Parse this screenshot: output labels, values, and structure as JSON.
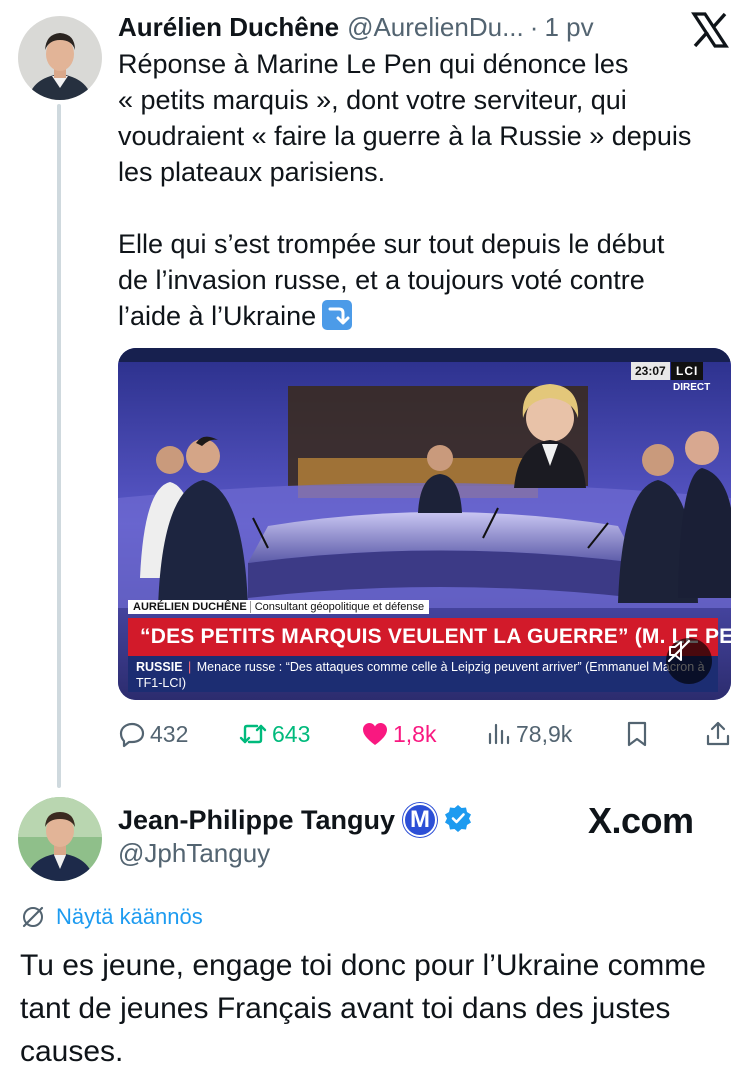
{
  "tweet1": {
    "author_name": "Aurélien Duchêne",
    "handle": "@AurelienDu...",
    "separator": "·",
    "time": "1 pv",
    "body": "Réponse à Marine Le Pen qui dénonce les\n« petits marquis », dont votre serviteur, qui\nvoudraient « faire la guerre à la Russie » depuis\nles plateaux parisiens.\n\nElle qui s’est trompée sur tout depuis le début\nde l’invasion russe, et a toujours voté contre\nl’aide à l’Ukraine",
    "emoji": "right-arrow-curving-down-emoji",
    "media": {
      "clock": "23:07",
      "channel": "LCI",
      "live_label": "DIRECT",
      "lower_third_name": "AURÉLIEN DUCHÊNE",
      "lower_third_role": "Consultant géopolitique et défense",
      "headline": "“DES PETITS MARQUIS VEULENT LA GUERRE” (M. LE PEN)",
      "ticker_label": "RUSSIE",
      "ticker_sep": "|",
      "ticker_text": "Menace russe : “Des attaques comme celle à Leipzig peuvent arriver” (Emmanuel Macron à TF1-LCI)",
      "mute_icon": "muted-speaker-icon"
    },
    "actions": {
      "replies": "432",
      "retweets": "643",
      "likes": "1,8k",
      "views": "78,9k"
    }
  },
  "tweet2": {
    "author_name": "Jean-Philippe Tanguy",
    "party_badge": "M",
    "handle": "@JphTanguy",
    "translate_label": "Näytä käännös",
    "body": "Tu es jeune, engage toi donc pour l’Ukraine comme tant de jeunes Français avant toi dans des justes causes."
  },
  "watermark": "X.com",
  "colors": {
    "text": "#0f1419",
    "muted": "#536471",
    "link": "#1d9bf0",
    "retweet": "#00ba7c",
    "like": "#f91880",
    "headline_red": "#d21a2a",
    "ticker_blue": "#1c2d72",
    "party_badge_blue": "#2c4fd6"
  }
}
